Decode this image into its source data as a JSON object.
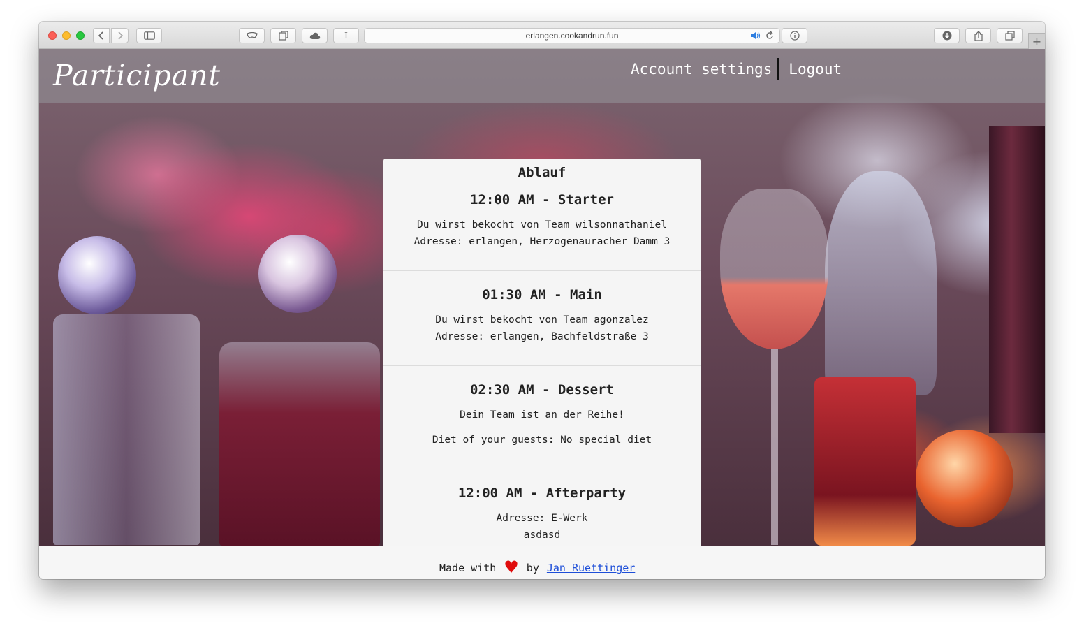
{
  "browser": {
    "url": "erlangen.cookandrun.fun",
    "reader_label": "I"
  },
  "site": {
    "brand": "Participant",
    "nav": {
      "account_settings": "Account settings",
      "logout": "Logout"
    }
  },
  "schedule": {
    "title": "Ablauf",
    "events": [
      {
        "time": "12:00 AM - Starter",
        "lines": [
          "Du wirst bekocht von Team wilsonnathaniel",
          "Adresse: erlangen, Herzogenauracher Damm 3"
        ]
      },
      {
        "time": "01:30 AM - Main",
        "lines": [
          "Du wirst bekocht von Team agonzalez",
          "Adresse: erlangen, Bachfeldstraße 3"
        ]
      },
      {
        "time": "02:30 AM - Dessert",
        "lines": [
          "Dein Team ist an der Reihe!",
          "Diet of your guests: No special diet"
        ]
      },
      {
        "time": "12:00 AM - Afterparty",
        "lines": [
          "Adresse: E-Werk",
          "asdasd"
        ]
      }
    ]
  },
  "footer": {
    "made_with": "Made with",
    "heart": "♥",
    "by": "by",
    "author": "Jan Ruettinger"
  },
  "colors": {
    "heart": "#e00d0d",
    "link": "#1d4ed8",
    "card_bg": "#f5f5f5"
  }
}
